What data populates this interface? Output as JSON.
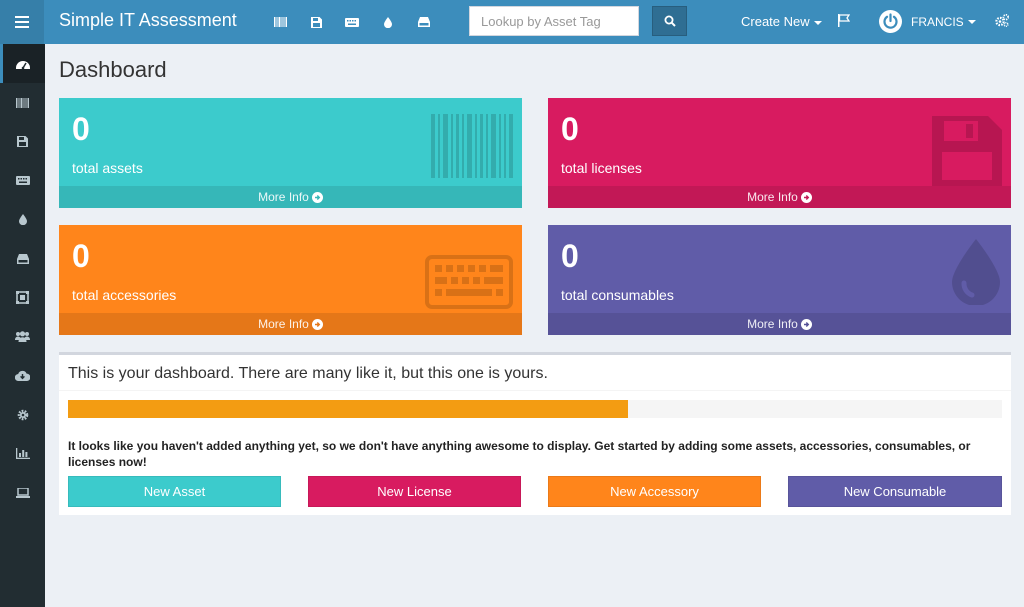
{
  "header": {
    "title": "Simple IT Assessment",
    "search_placeholder": "Lookup by Asset Tag",
    "create_new": "Create New",
    "username": "FRANCIS",
    "icons": [
      "barcode-icon",
      "floppy-disk-icon",
      "keyboard-icon",
      "droplet-icon",
      "hard-drive-icon"
    ]
  },
  "sidebar": {
    "items": [
      "dashboard-icon",
      "barcode-icon",
      "floppy-disk-icon",
      "keyboard-icon",
      "droplet-icon",
      "hard-drive-icon",
      "components-icon",
      "users-icon",
      "cloud-download-icon",
      "gear-icon",
      "bar-chart-icon",
      "laptop-icon"
    ]
  },
  "page": {
    "title": "Dashboard"
  },
  "boxes": {
    "assets": {
      "count": "0",
      "label": "total assets",
      "more": "More Info",
      "color": "#3ccbcc"
    },
    "licenses": {
      "count": "0",
      "label": "total licenses",
      "more": "More Info",
      "color": "#d81b60"
    },
    "accessories": {
      "count": "0",
      "label": "total accessories",
      "more": "More Info",
      "color": "#ff851b"
    },
    "consumables": {
      "count": "0",
      "label": "total consumables",
      "more": "More Info",
      "color": "#605ca8"
    }
  },
  "welcome": {
    "title": "This is your dashboard. There are many like it, but this one is yours.",
    "progress_fraction": 0.6,
    "progress_color": "#f39c12",
    "notice": "It looks like you haven't added anything yet, so we don't have anything awesome to display. Get started by adding some assets, accessories, consumables, or licenses now!",
    "buttons": {
      "asset": "New Asset",
      "license": "New License",
      "accessory": "New Accessory",
      "consumable": "New Consumable"
    }
  }
}
